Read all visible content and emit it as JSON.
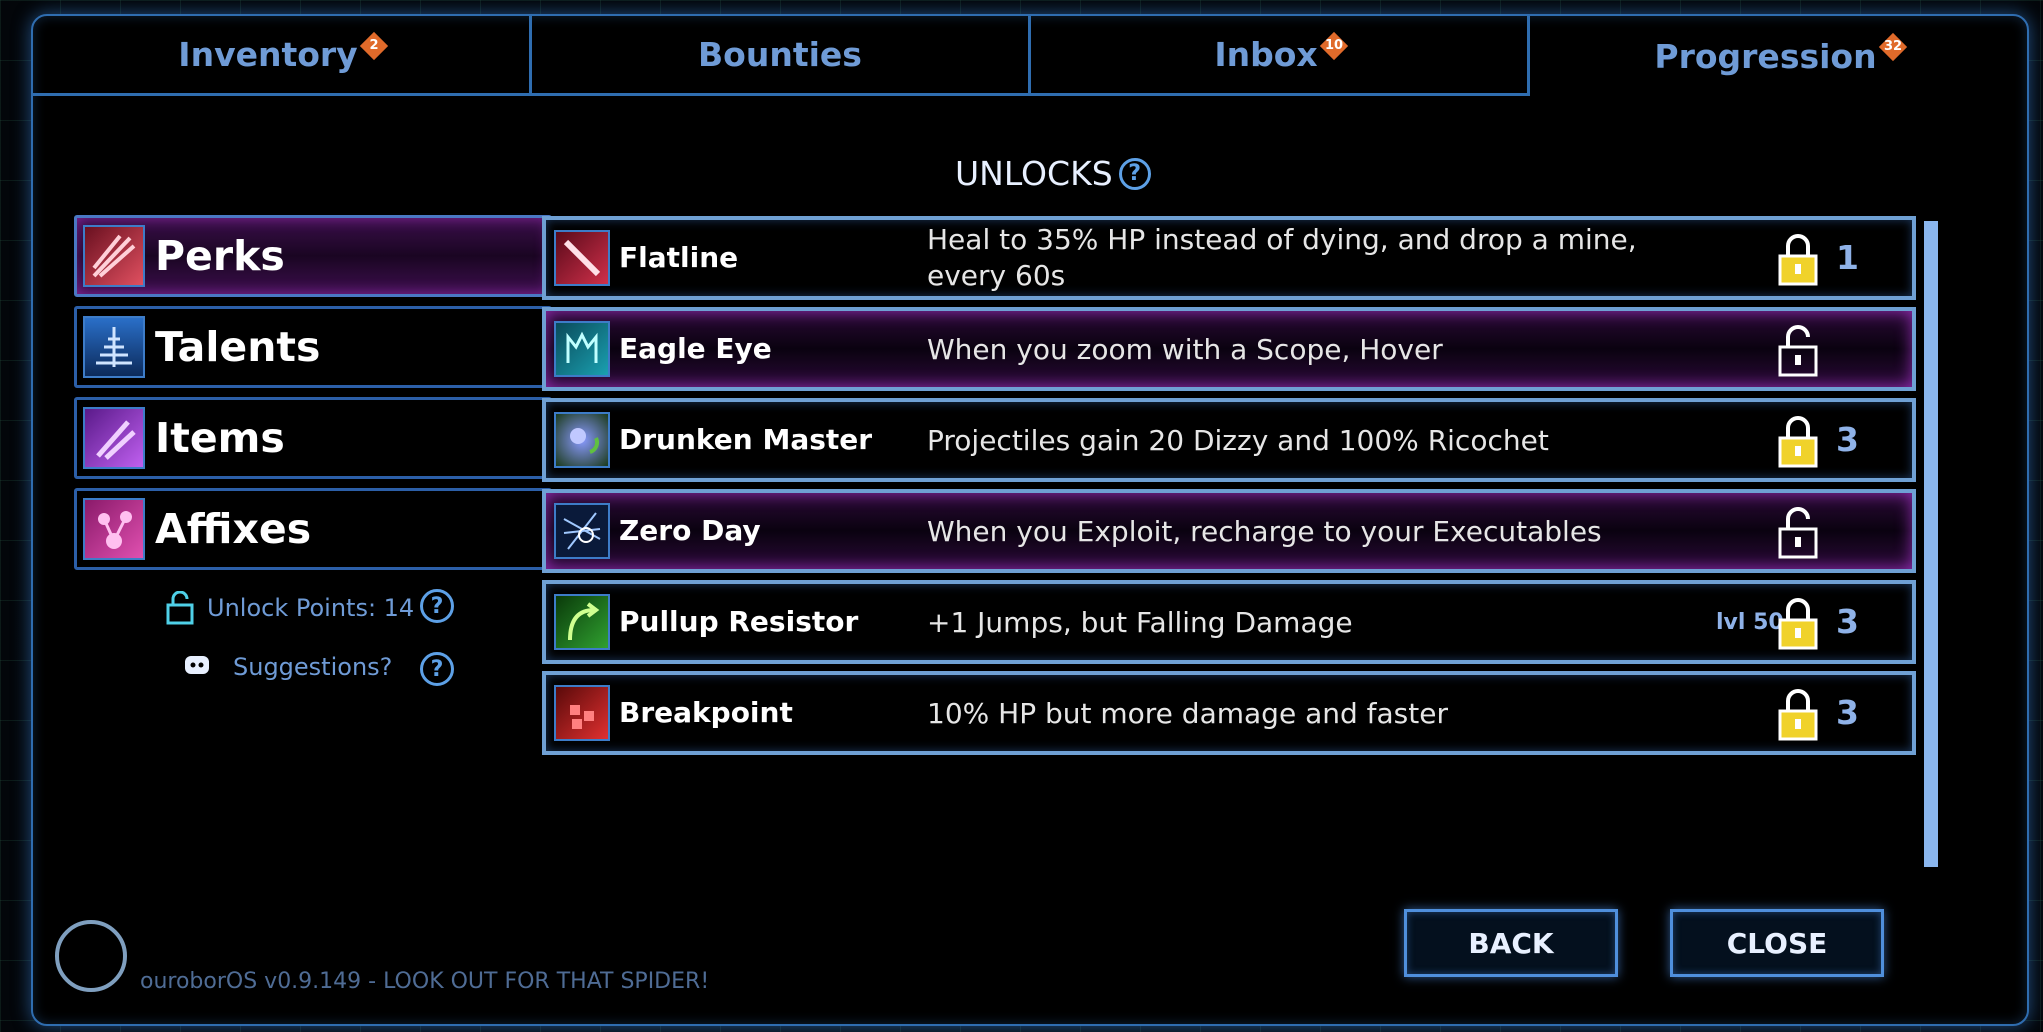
{
  "tabs": [
    {
      "label": "Inventory",
      "badge": "2",
      "active": false
    },
    {
      "label": "Bounties",
      "badge": "",
      "active": false
    },
    {
      "label": "Inbox",
      "badge": "10",
      "active": false
    },
    {
      "label": "Progression",
      "badge": "32",
      "active": true
    }
  ],
  "title": "UNLOCKS",
  "help_glyph": "?",
  "categories": [
    {
      "label": "Perks",
      "icon": "perks-icon",
      "active": true
    },
    {
      "label": "Talents",
      "icon": "talents-icon",
      "active": false
    },
    {
      "label": "Items",
      "icon": "items-icon",
      "active": false
    },
    {
      "label": "Affixes",
      "icon": "affixes-icon",
      "active": false
    }
  ],
  "unlock_points": "Unlock Points: 14",
  "suggestions": "Suggestions?",
  "unlocks": [
    {
      "name": "Flatline",
      "desc": "Heal to 35% HP instead of dying, and drop a mine, every 60s",
      "cost": "1",
      "level": "",
      "state": "locked-gold",
      "highlight": false
    },
    {
      "name": "Eagle Eye",
      "desc": "When you zoom with a Scope, Hover",
      "cost": "",
      "level": "",
      "state": "unlocked",
      "highlight": true
    },
    {
      "name": "Drunken Master",
      "desc": "Projectiles gain 20 Dizzy and 100% Ricochet",
      "cost": "3",
      "level": "",
      "state": "locked-gold",
      "highlight": false
    },
    {
      "name": "Zero Day",
      "desc": "When you Exploit, recharge to your Executables",
      "cost": "",
      "level": "",
      "state": "unlocked",
      "highlight": true
    },
    {
      "name": "Pullup Resistor",
      "desc": "+1 Jumps, but Falling Damage",
      "cost": "3",
      "level": "lvl 50",
      "state": "locked-gold",
      "highlight": false
    },
    {
      "name": "Breakpoint",
      "desc": "10% HP but more damage and faster",
      "cost": "3",
      "level": "",
      "state": "locked-gold",
      "highlight": false
    }
  ],
  "buttons": {
    "back": "BACK",
    "close": "CLOSE"
  },
  "version": "ouroborOS  v0.9.149 - LOOK OUT FOR THAT SPIDER!",
  "colors": {
    "accent": "#2f6db0",
    "highlight": "#c03ce6",
    "gold": "#f0d22a"
  }
}
